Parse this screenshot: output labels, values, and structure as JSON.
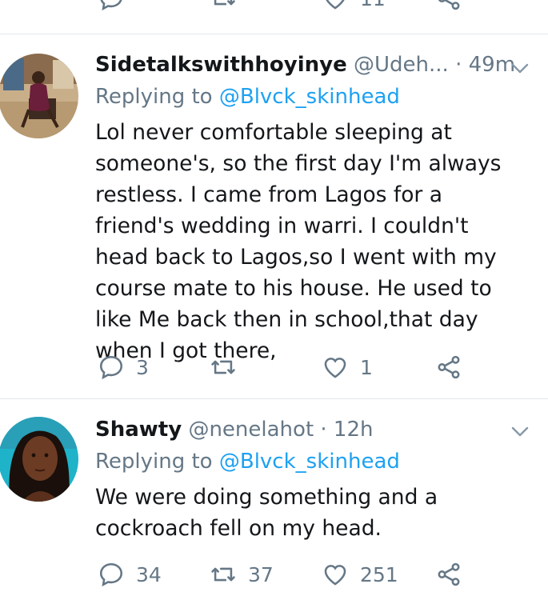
{
  "tweets": [
    {
      "name": "Sidetalkswithhoyinye",
      "handle": "@Udeh...",
      "time": "· 49m",
      "replying_label": "Replying to",
      "replying_handle": "@Blvck_skinhead",
      "text": "Lol never comfortable sleeping at someone's, so the first day I'm always restless. I came from Lagos for a friend's wedding in warri. I couldn't head back to Lagos,so I went with my course mate to his house. He used to like Me back then in school,that day when I got there,",
      "replies": "3",
      "retweets": "",
      "likes": "1"
    },
    {
      "name": "Shawty",
      "handle": "@nenelahot",
      "time": "· 12h",
      "replying_label": "Replying to",
      "replying_handle": "@Blvck_skinhead",
      "text": "We were doing something and a cockroach fell on my head.",
      "replies": "34",
      "retweets": "37",
      "likes": "251"
    }
  ],
  "previous_tweet": {
    "likes": "11"
  },
  "colors": {
    "accent": "#1da1f2",
    "muted": "#657786",
    "text": "#14171a",
    "divider": "#e1e8ed"
  },
  "icons": [
    "reply-icon",
    "retweet-icon",
    "like-icon",
    "share-icon",
    "chevron-down-icon",
    "avatar"
  ]
}
